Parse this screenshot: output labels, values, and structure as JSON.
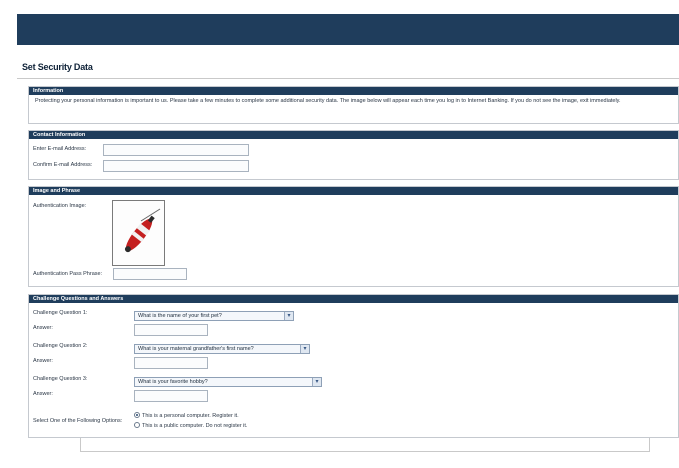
{
  "page": {
    "title": "Set Security Data"
  },
  "colors": {
    "banner": "#1f3d5c",
    "section_header": "#1f3d5c",
    "border": "#c5c9cf"
  },
  "information": {
    "header": "Information",
    "text": "Protecting your personal information is important to us. Please take a few minutes to complete some additional security data. The image below will appear each time you log in to Internet Banking. If you do not see the image, exit immediately."
  },
  "contact": {
    "header": "Contact Information",
    "email_label": "Enter E-mail Address:",
    "confirm_label": "Confirm E-mail Address:",
    "email_value": "",
    "confirm_value": ""
  },
  "image_phrase": {
    "header": "Image and Phrase",
    "image_label": "Authentication Image:",
    "phrase_label": "Authentication Pass Phrase:",
    "image_icon": "fishing-bobber-icon",
    "phrase_value": ""
  },
  "challenge": {
    "header": "Challenge Questions and Answers",
    "answer_label": "Answer:",
    "questions": [
      {
        "label": "Challenge Question 1:",
        "selected": "What is the name of your first pet?",
        "answer": ""
      },
      {
        "label": "Challenge Question 2:",
        "selected": "What is your maternal grandfather's first name?",
        "answer": ""
      },
      {
        "label": "Challenge Question 3:",
        "selected": "What is your favorite hobby?",
        "answer": ""
      }
    ],
    "options_label": "Select One of the Following Options:",
    "options": [
      {
        "text": "This is a personal computer. Register it.",
        "selected": true
      },
      {
        "text": "This is a public computer. Do not register it.",
        "selected": false
      }
    ]
  }
}
